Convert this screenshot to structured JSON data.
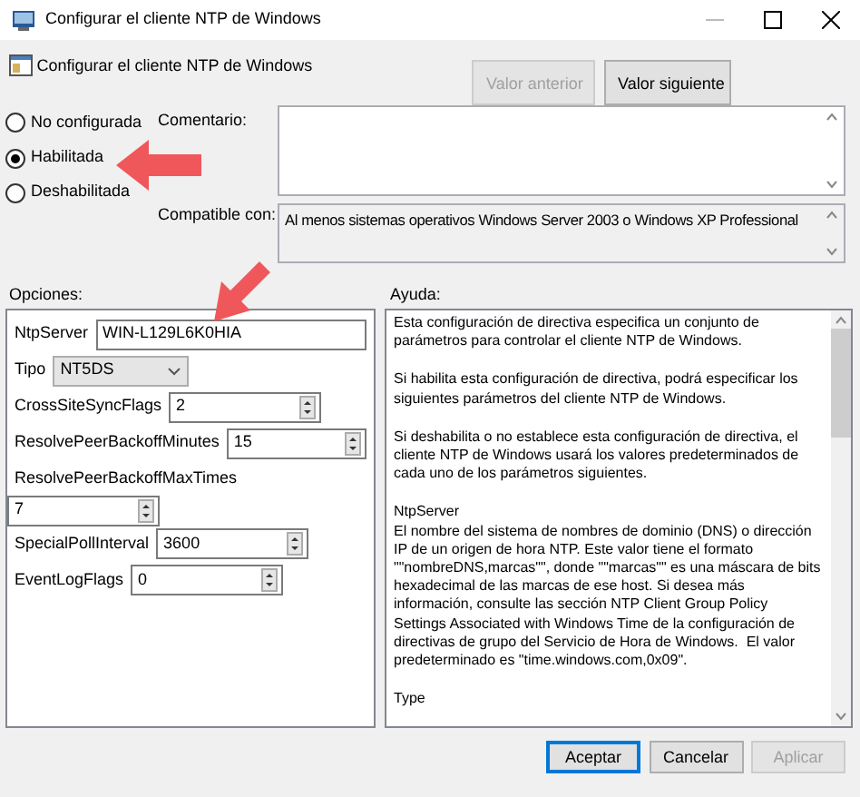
{
  "window": {
    "title": "Configurar el cliente NTP de Windows"
  },
  "header": {
    "title": "Configurar el cliente NTP de Windows",
    "buttons": [
      {
        "label": "Valor anterior",
        "disabled": true
      },
      {
        "label": "Valor siguiente",
        "disabled": false
      }
    ]
  },
  "states": [
    {
      "label": "No configurada",
      "selected": false
    },
    {
      "label": "Habilitada",
      "selected": true
    },
    {
      "label": "Deshabilitada",
      "selected": false
    }
  ],
  "comment": {
    "label": "Comentario:"
  },
  "compatible": {
    "label": "Compatible con:",
    "value": "Al menos sistemas operativos Windows Server 2003 o Windows XP Professional"
  },
  "options": {
    "label": "Opciones:",
    "fields": [
      {
        "kind": "text",
        "label": "NtpServer",
        "value": "WIN-L129L6K0HIA"
      },
      {
        "kind": "select",
        "label": "Tipo",
        "value": "NT5DS"
      },
      {
        "kind": "spin",
        "label": "CrossSiteSyncFlags",
        "value": "2",
        "stacked": false
      },
      {
        "kind": "spin",
        "label": "ResolvePeerBackoffMinutes",
        "value": "15",
        "stacked": false
      },
      {
        "kind": "spin",
        "label": "ResolvePeerBackoffMaxTimes",
        "value": "7",
        "stacked": true
      },
      {
        "kind": "spin",
        "label": "SpecialPollInterval",
        "value": "3600",
        "stacked": false
      },
      {
        "kind": "spin",
        "label": "EventLogFlags",
        "value": "0",
        "stacked": false
      }
    ]
  },
  "help": {
    "label": "Ayuda:",
    "paragraphs": [
      "Esta configuración de directiva especifica un conjunto de parámetros para controlar el cliente NTP de Windows.",
      "Si habilita esta configuración de directiva, podrá especificar los siguientes parámetros del cliente NTP de Windows.",
      "Si deshabilita o no establece esta configuración de directiva, el cliente NTP de Windows usará los valores predeterminados de cada uno de los parámetros siguientes.",
      "NtpServer\nEl nombre del sistema de nombres de dominio (DNS) o dirección IP de un origen de hora NTP. Este valor tiene el formato \"\"nombreDNS,marcas\"\", donde \"\"marcas\"\" es una máscara de bits hexadecimal de las marcas de ese host. Si desea más información, consulte las sección NTP Client Group Policy Settings Associated with Windows Time de la configuración de directivas de grupo del Servicio de Hora de Windows.  El valor predeterminado es \"time.windows.com,0x09\".",
      "Type"
    ]
  },
  "footer": {
    "buttons": [
      {
        "label": "Aceptar",
        "disabled": false,
        "default": true
      },
      {
        "label": "Cancelar",
        "disabled": false,
        "default": false
      },
      {
        "label": "Aplicar",
        "disabled": true,
        "default": false
      }
    ]
  }
}
